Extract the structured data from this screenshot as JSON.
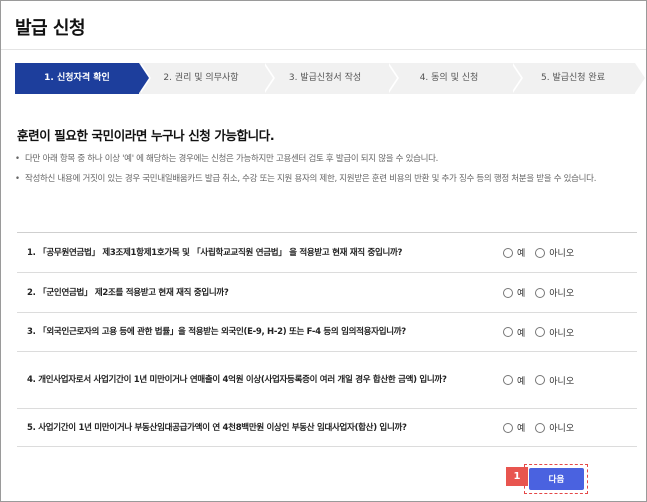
{
  "page": {
    "title": "발급 신청"
  },
  "steps": [
    {
      "label": "1. 신청자격 확인",
      "active": true
    },
    {
      "label": "2. 권리 및 의무사항",
      "active": false
    },
    {
      "label": "3. 발급신청서 작성",
      "active": false
    },
    {
      "label": "4. 동의 및 신청",
      "active": false
    },
    {
      "label": "5. 발급신청 완료",
      "active": false
    }
  ],
  "eligibility": {
    "heading": "훈련이 필요한 국민이라면 누구나 신청 가능합니다.",
    "notes": [
      "다만 아래 항목 중 하나 이상 '예' 에 해당하는 경우에는 신청은 가능하지만 고용센터 검토 후 발급이 되지 않을 수 있습니다.",
      "작성하신 내용에 거짓이 있는 경우 국민내일배움카드 발급 취소, 수강 또는 지원 용자의 제한, 지원받은 훈련 비용의 반환 및 추가 징수 등의 행정 처분을 받을 수 있습니다."
    ]
  },
  "questions": [
    {
      "text": "1. 「공무원연금법」 제3조제1항제1호가목 및 「사립학교교직원 연금법」 을 적용받고 현재 재직 중입니까?",
      "yes": "예",
      "no": "아니오"
    },
    {
      "text": "2. 「군인연금법」 제2조를 적용받고 현재 재직 중입니까?",
      "yes": "예",
      "no": "아니오"
    },
    {
      "text": "3. 「외국인근로자의 고용 등에 관한 법률」을 적용받는 외국인(E-9, H-2) 또는 F-4 등의 임의적용자입니까?",
      "yes": "예",
      "no": "아니오"
    },
    {
      "text": "4. 개인사업자로서 사업기간이 1년 미만이거나 연매출이 4억원 이상(사업자등록증이 여러 개일 경우 합산한 금액) 입니까?",
      "yes": "예",
      "no": "아니오"
    },
    {
      "text": "5. 사업기간이 1년 미만이거나 부동산임대공급가액이 연 4천8백만원 이상인 부동산 임대사업자(합산) 입니까?",
      "yes": "예",
      "no": "아니오"
    }
  ],
  "actions": {
    "next_label": "다음",
    "annotation_badge": "1"
  },
  "colors": {
    "step_active": "#1d3e9c",
    "step_inactive": "#f1f1f1",
    "next_button": "#4a62e0",
    "badge": "#e8554f"
  }
}
